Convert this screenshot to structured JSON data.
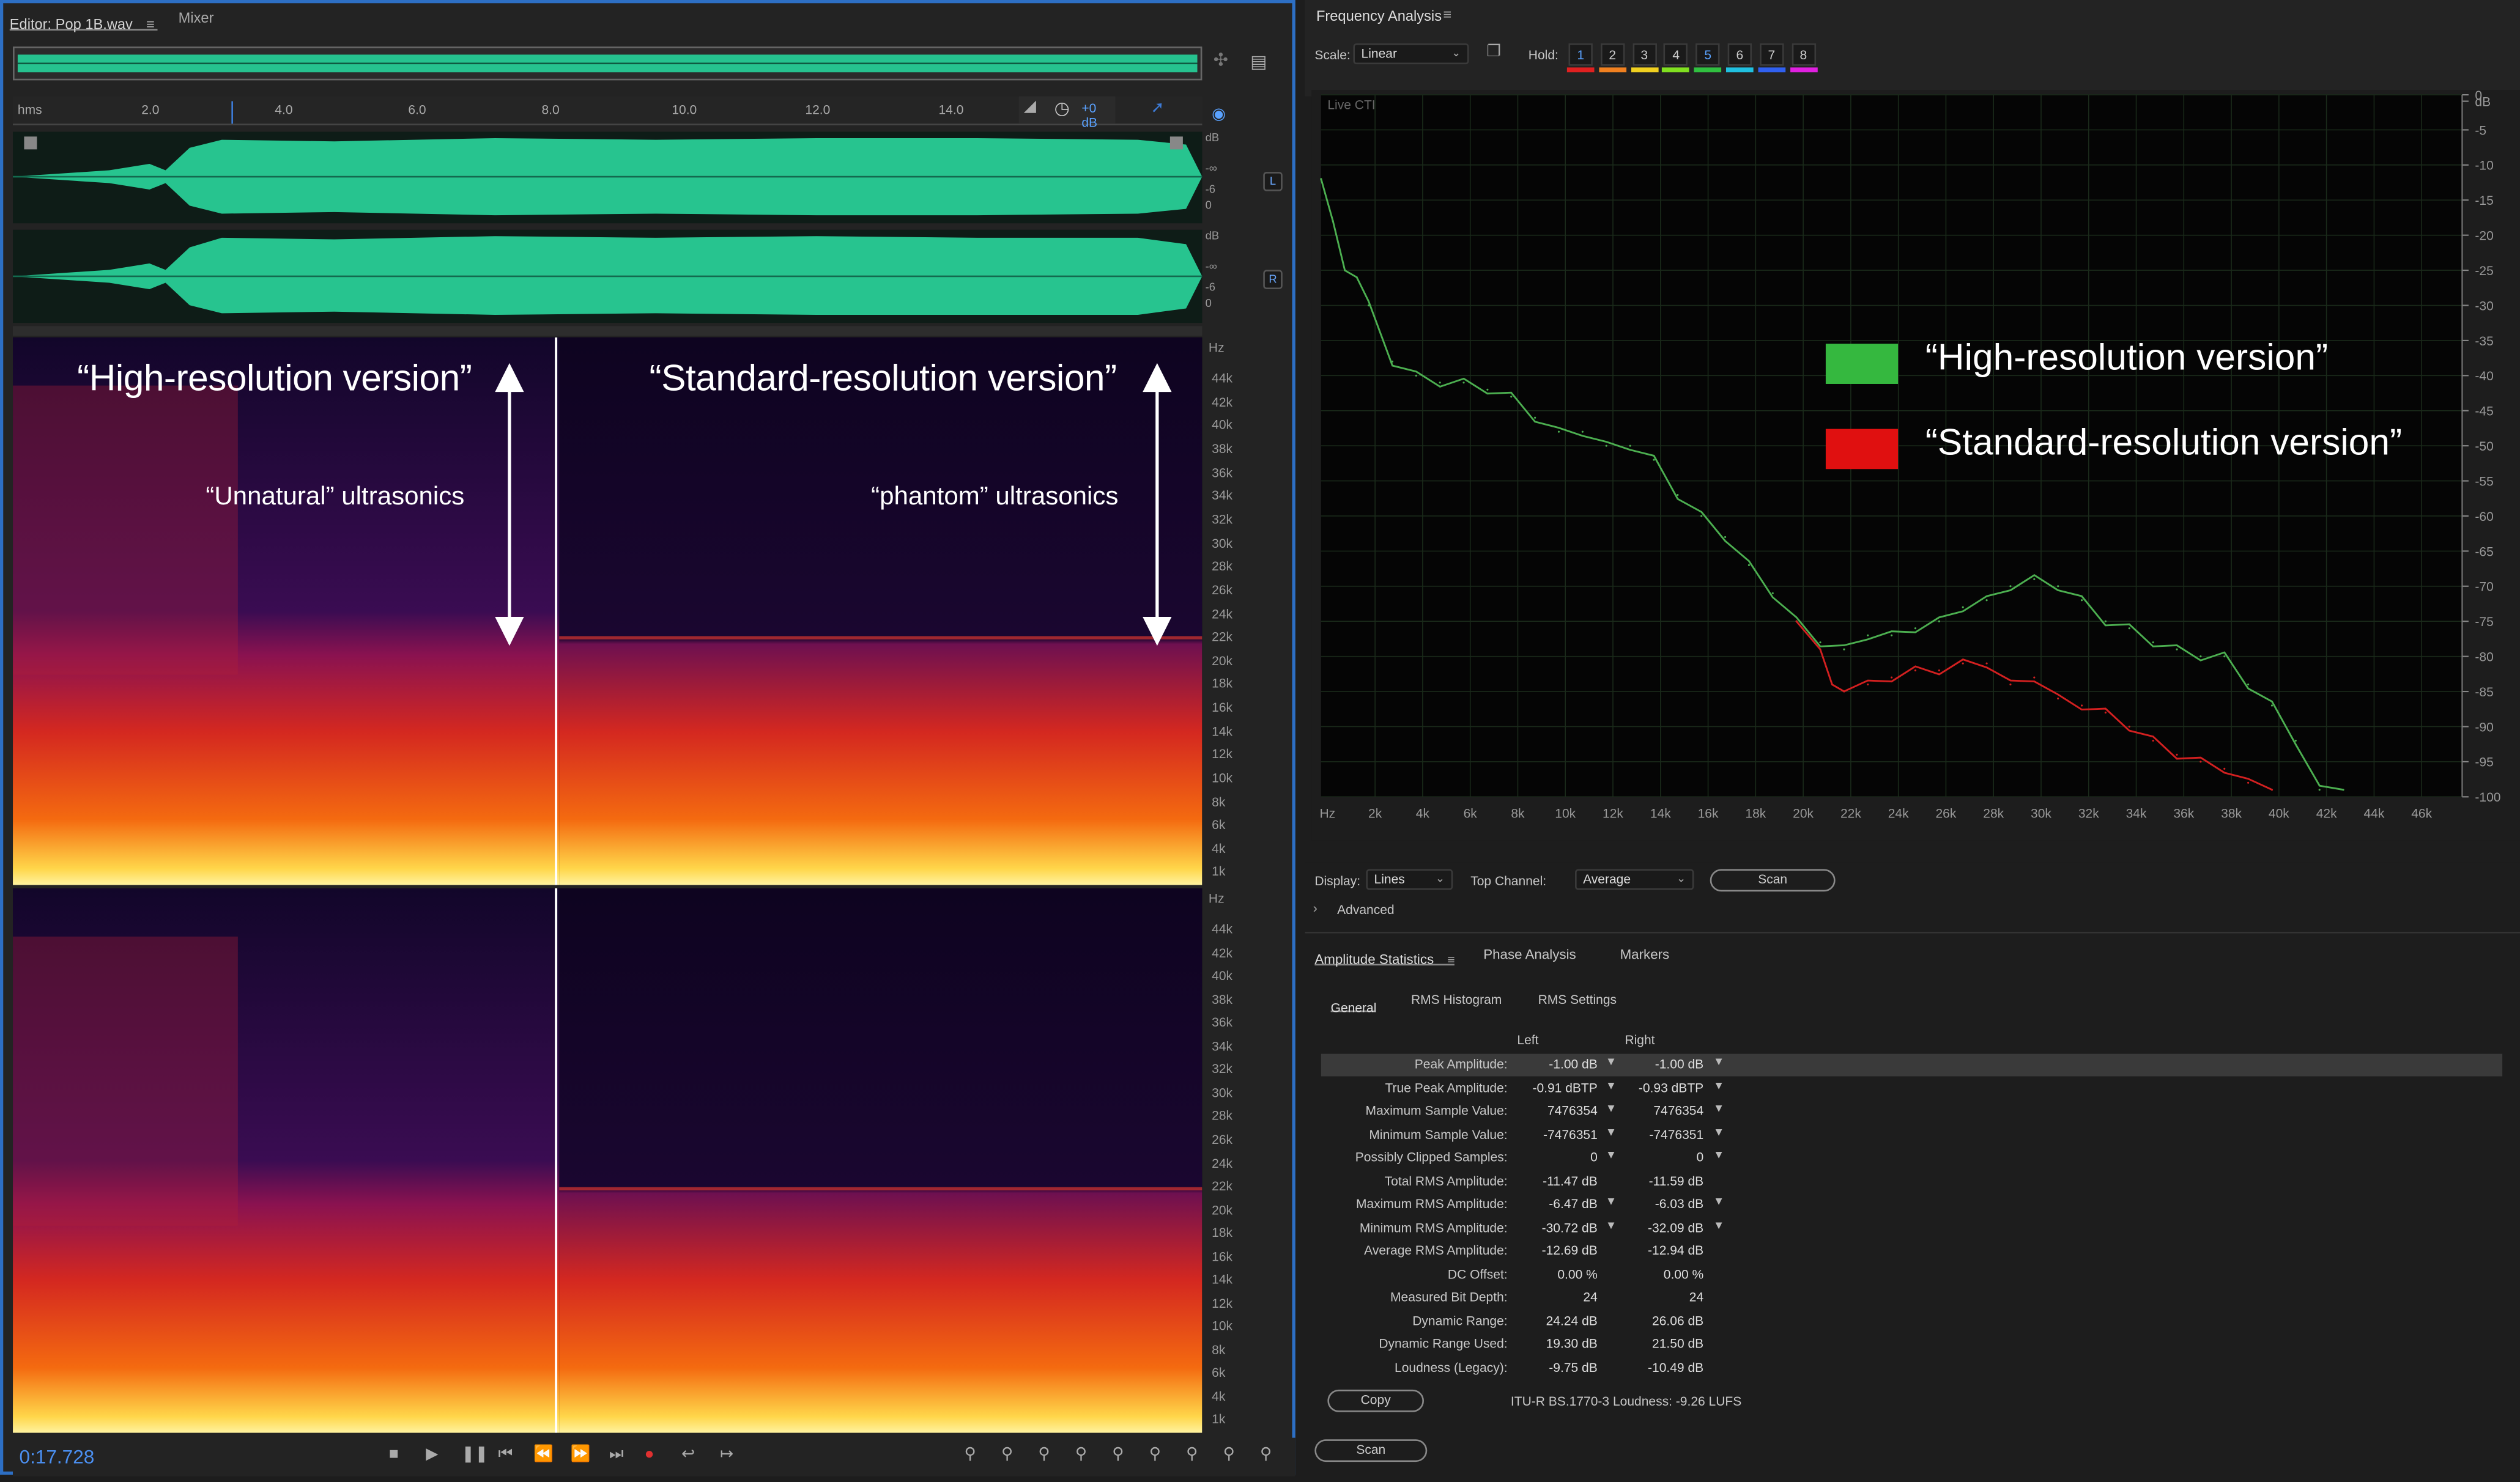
{
  "editor": {
    "tab_title": "Editor: Pop 1B.wav",
    "tab_mixer": "Mixer",
    "ruler_unit": "hms",
    "ruler_ticks": [
      "2.0",
      "4.0",
      "6.0",
      "8.0",
      "10.0",
      "12.0",
      "14.0"
    ],
    "gain_label": "+0 dB",
    "wave_scale_L": [
      "dB",
      "-∞",
      "-6",
      "0"
    ],
    "wave_scale_R": [
      "dB",
      "-∞",
      "-6",
      "0"
    ],
    "chan_L": "L",
    "chan_R": "R",
    "hz_unit": "Hz",
    "hz_ticks": [
      "44k",
      "42k",
      "40k",
      "38k",
      "36k",
      "34k",
      "32k",
      "30k",
      "28k",
      "26k",
      "24k",
      "22k",
      "20k",
      "18k",
      "16k",
      "14k",
      "12k",
      "10k",
      "8k",
      "6k",
      "4k",
      "1k"
    ],
    "annotations": {
      "hires": "“High-resolution version”",
      "stdres": "“Standard-resolution version”",
      "unnatural": "“Unnatural” ultrasonics",
      "phantom": "“phantom” ultrasonics"
    },
    "time_display": "0:17.728"
  },
  "freq": {
    "title": "Frequency Analysis",
    "scale_label": "Scale:",
    "scale_value": "Linear",
    "hold_label": "Hold:",
    "hold_buttons": [
      "1",
      "2",
      "3",
      "4",
      "5",
      "6",
      "7",
      "8"
    ],
    "hold_colors": [
      "#e02020",
      "#f08020",
      "#f0d020",
      "#80e020",
      "#30c040",
      "#20c0e0",
      "#3060f0",
      "#e020e0"
    ],
    "live_label": "Live CTI",
    "db_ticks": [
      "dB",
      "0",
      "-5",
      "-10",
      "-15",
      "-20",
      "-25",
      "-30",
      "-35",
      "-40",
      "-45",
      "-50",
      "-55",
      "-60",
      "-65",
      "-70",
      "-75",
      "-80",
      "-85",
      "-90",
      "-95",
      "-100"
    ],
    "hz_ticks": [
      "Hz",
      "2k",
      "4k",
      "6k",
      "8k",
      "10k",
      "12k",
      "14k",
      "16k",
      "18k",
      "20k",
      "22k",
      "24k",
      "26k",
      "28k",
      "30k",
      "32k",
      "34k",
      "36k",
      "38k",
      "40k",
      "42k",
      "44k",
      "46k"
    ],
    "legend_hires": "“High-resolution version”",
    "legend_stdres": "“Standard-resolution version”",
    "display_label": "Display:",
    "display_value": "Lines",
    "top_channel_label": "Top Channel:",
    "top_channel_value": "Average",
    "scan_label": "Scan",
    "advanced_label": "Advanced"
  },
  "chart_data": {
    "type": "line",
    "xlabel": "Hz",
    "ylabel": "dB",
    "xlim": [
      0,
      48000
    ],
    "ylim": [
      -100,
      0
    ],
    "series": [
      {
        "name": "“High-resolution version”",
        "color": "#4caf50",
        "x": [
          0,
          500,
          1000,
          1500,
          2000,
          3000,
          4000,
          5000,
          6000,
          7000,
          8000,
          9000,
          10000,
          11000,
          12000,
          13000,
          14000,
          15000,
          16000,
          17000,
          18000,
          19000,
          20000,
          21000,
          22000,
          23000,
          24000,
          25000,
          26000,
          27000,
          28000,
          29000,
          30000,
          31000,
          32000,
          33000,
          34000,
          35000,
          36000,
          37000,
          38000,
          39000,
          40000,
          41000,
          42000,
          43000
        ],
        "y": [
          -12,
          -18,
          -25,
          -26,
          -30,
          -38,
          -40,
          -41,
          -41,
          -42,
          -43,
          -46,
          -48,
          -48,
          -50,
          -50,
          -52,
          -57,
          -60,
          -63,
          -67,
          -71,
          -75,
          -78,
          -79,
          -77,
          -77,
          -76,
          -75,
          -73,
          -72,
          -70,
          -69,
          -70,
          -72,
          -75,
          -76,
          -78,
          -79,
          -80,
          -80,
          -84,
          -87,
          -92,
          -99,
          -99
        ]
      },
      {
        "name": "“Standard-resolution version”",
        "color": "#d32020",
        "x": [
          20000,
          21000,
          21500,
          22000,
          23000,
          24000,
          25000,
          26000,
          27000,
          28000,
          29000,
          30000,
          31000,
          32000,
          33000,
          34000,
          35000,
          36000,
          37000,
          38000,
          39000,
          40000
        ],
        "y": [
          -75,
          -79,
          -84,
          -85,
          -84,
          -83,
          -82,
          -82,
          -81,
          -81,
          -84,
          -83,
          -86,
          -87,
          -88,
          -90,
          -92,
          -94,
          -95,
          -96,
          -98,
          -99
        ]
      }
    ]
  },
  "amp": {
    "tabs": [
      "Amplitude Statistics",
      "Phase Analysis",
      "Markers"
    ],
    "subtabs": [
      "General",
      "RMS Histogram",
      "RMS Settings"
    ],
    "col_left": "Left",
    "col_right": "Right",
    "rows": [
      {
        "label": "Peak Amplitude:",
        "left": "-1.00 dB",
        "right": "-1.00 dB",
        "flag": true
      },
      {
        "label": "True Peak Amplitude:",
        "left": "-0.91 dBTP",
        "right": "-0.93 dBTP",
        "flag": true
      },
      {
        "label": "Maximum Sample Value:",
        "left": "7476354",
        "right": "7476354",
        "flag": true
      },
      {
        "label": "Minimum Sample Value:",
        "left": "-7476351",
        "right": "-7476351",
        "flag": true
      },
      {
        "label": "Possibly Clipped Samples:",
        "left": "0",
        "right": "0",
        "flag": true
      },
      {
        "label": "Total RMS Amplitude:",
        "left": "-11.47 dB",
        "right": "-11.59 dB",
        "flag": false
      },
      {
        "label": "Maximum RMS Amplitude:",
        "left": "-6.47 dB",
        "right": "-6.03 dB",
        "flag": true
      },
      {
        "label": "Minimum RMS Amplitude:",
        "left": "-30.72 dB",
        "right": "-32.09 dB",
        "flag": true
      },
      {
        "label": "Average RMS Amplitude:",
        "left": "-12.69 dB",
        "right": "-12.94 dB",
        "flag": false
      },
      {
        "label": "DC Offset:",
        "left": "0.00 %",
        "right": "0.00 %",
        "flag": false
      },
      {
        "label": "Measured Bit Depth:",
        "left": "24",
        "right": "24",
        "flag": false
      },
      {
        "label": "Dynamic Range:",
        "left": "24.24 dB",
        "right": "26.06 dB",
        "flag": false
      },
      {
        "label": "Dynamic Range Used:",
        "left": "19.30 dB",
        "right": "21.50 dB",
        "flag": false
      },
      {
        "label": "Loudness (Legacy):",
        "left": "-9.75 dB",
        "right": "-10.49 dB",
        "flag": false
      }
    ],
    "copy_label": "Copy",
    "loudness_text": "ITU-R BS.1770-3 Loudness: -9.26 LUFS",
    "scan_label": "Scan"
  }
}
